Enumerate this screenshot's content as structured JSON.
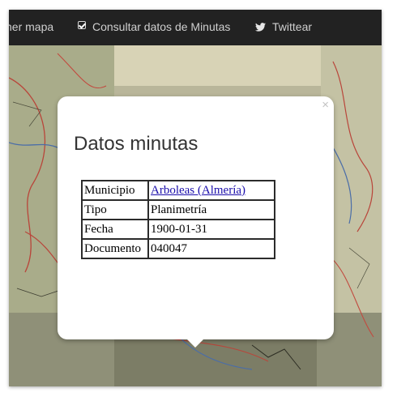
{
  "nav": {
    "items": [
      {
        "label": "ner mapa",
        "icon": ""
      },
      {
        "label": "Consultar datos de Minutas",
        "icon": "checkbox-checked-icon"
      },
      {
        "label": "Twittear",
        "icon": "twitter-icon"
      }
    ]
  },
  "popup": {
    "close_label": "×",
    "title": "Datos minutas",
    "rows": [
      {
        "key": "Municipio",
        "value": "Arboleas (Almería)",
        "link": true
      },
      {
        "key": "Tipo",
        "value": "Planimetría"
      },
      {
        "key": "Fecha",
        "value": "1900-01-31"
      },
      {
        "key": "Documento",
        "value": "040047"
      }
    ]
  },
  "colors": {
    "navbar": "#222222",
    "nav_text": "#cfcfcf",
    "link": "#1a0dab"
  }
}
